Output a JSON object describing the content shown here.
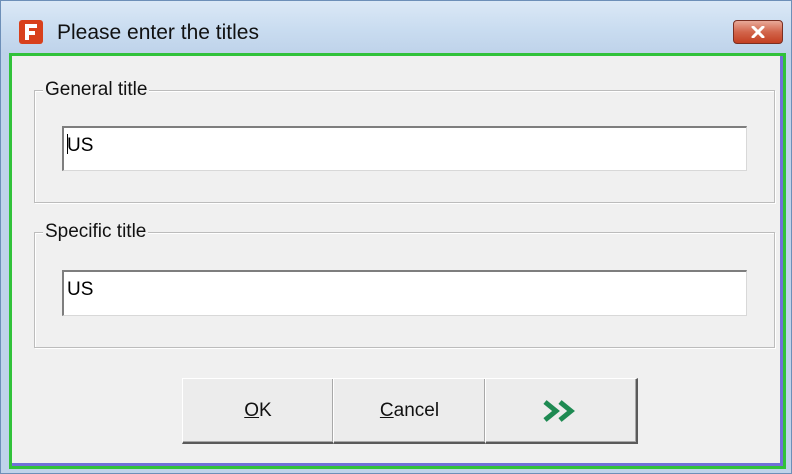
{
  "window": {
    "title": "Please enter the titles",
    "icon": "app-f-icon",
    "close_icon": "close-icon"
  },
  "general": {
    "label": "General title",
    "value": "US"
  },
  "specific": {
    "label": "Specific title",
    "value": "US"
  },
  "buttons": {
    "ok": {
      "accel": "O",
      "rest": "K"
    },
    "cancel": {
      "accel": "C",
      "rest": "ancel"
    },
    "forward_icon": "double-chevron-right-icon"
  },
  "colors": {
    "focus_green": "#31c23a",
    "focus_blue": "#7170d8",
    "chevron_green": "#1e8a52",
    "close_red": "#c33f22"
  }
}
